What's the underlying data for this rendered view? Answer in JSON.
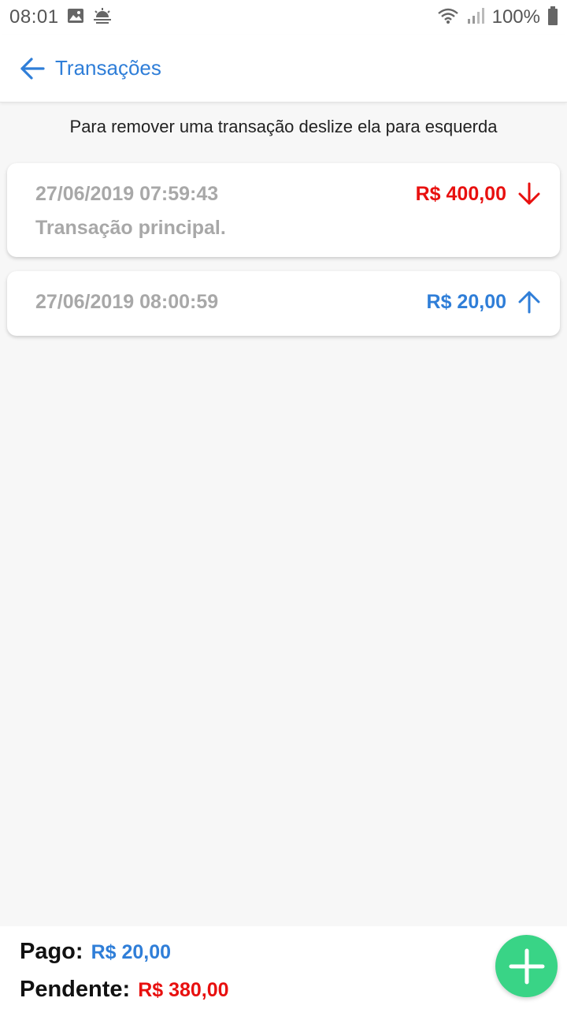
{
  "status_bar": {
    "time": "08:01",
    "battery": "100%",
    "icons": [
      "image-icon",
      "weather-icon",
      "wifi-icon",
      "signal-icon",
      "battery-icon"
    ]
  },
  "app_bar": {
    "title": "Transações",
    "back_icon": "arrow-left-icon",
    "accent_color": "#2f7ed8"
  },
  "hint": "Para remover uma transação deslize ela para esquerda",
  "transactions": [
    {
      "datetime": "27/06/2019 07:59:43",
      "amount": "R$ 400,00",
      "description": "Transação principal.",
      "direction_icon": "arrow-down-icon",
      "color": "#e8100f"
    },
    {
      "datetime": "27/06/2019 08:00:59",
      "amount": "R$ 20,00",
      "direction_icon": "arrow-up-icon",
      "color": "#2f7ed8"
    }
  ],
  "summary": {
    "paid_label": "Pago:",
    "paid_value": "R$ 20,00",
    "pending_label": "Pendente:",
    "pending_value": "R$ 380,00"
  },
  "fab": {
    "icon": "plus-icon",
    "color": "#39d486"
  }
}
